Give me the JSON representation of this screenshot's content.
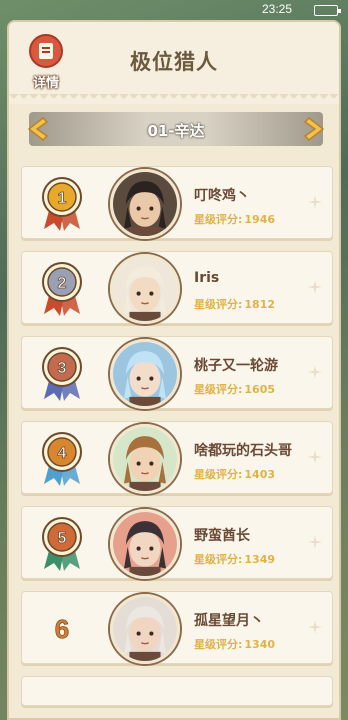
{
  "status_bar": {
    "time": "23:25"
  },
  "header": {
    "title": "极位猎人",
    "detail_label": "详情"
  },
  "selector": {
    "label": "01-辛达"
  },
  "rows": [
    {
      "rank": "1",
      "name": "叮咚鸡丶",
      "score_label": "星级评分:",
      "score": "1946",
      "medal_color": "#e8a82a",
      "ribbon_color": "#c94b2e",
      "avatar_bg": "#5b4a3e",
      "hair": "#2b2320",
      "skin": "#e9c9a8"
    },
    {
      "rank": "2",
      "name": "Iris",
      "score_label": "星级评分:",
      "score": "1812",
      "medal_color": "#9aa0b3",
      "ribbon_color": "#c94b2e",
      "avatar_bg": "#efe8da",
      "hair": "#f3ecdc",
      "skin": "#f2dac3"
    },
    {
      "rank": "3",
      "name": "桃子又一轮游",
      "score_label": "星级评分:",
      "score": "1605",
      "medal_color": "#c46a4f",
      "ribbon_color": "#5b6bb5",
      "avatar_bg": "#9cc6e0",
      "hair": "#bfe3f5",
      "skin": "#f2dcca"
    },
    {
      "rank": "4",
      "name": "啥都玩的石头哥",
      "score_label": "星级评分:",
      "score": "1403",
      "medal_color": "#d9872e",
      "ribbon_color": "#4f9fd0",
      "avatar_bg": "#d6e6c8",
      "hair": "#a8703c",
      "skin": "#f0d2b5"
    },
    {
      "rank": "5",
      "name": "野蛮酋长",
      "score_label": "星级评分:",
      "score": "1349",
      "medal_color": "#d06a37",
      "ribbon_color": "#3d8f6a",
      "avatar_bg": "#e7a08c",
      "hair": "#3b3136",
      "skin": "#f1d6c2"
    },
    {
      "rank": "6",
      "name": "孤星望月丶",
      "score_label": "星级评分:",
      "score": "1340",
      "medal_color": "#d0803a",
      "ribbon_color": "#d0803a",
      "avatar_bg": "#e3ddd6",
      "hair": "#ece7e1",
      "skin": "#f0d5c0"
    }
  ]
}
